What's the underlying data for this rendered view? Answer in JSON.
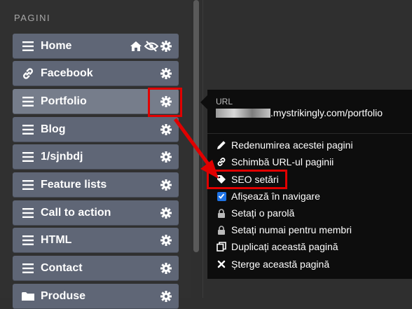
{
  "sidebar": {
    "title": "PAGINI",
    "items": [
      {
        "label": "Home",
        "icon": "hamburger-icon",
        "extra_icons": [
          "home-icon",
          "eye-slash-icon"
        ]
      },
      {
        "label": "Facebook",
        "icon": "link-icon"
      },
      {
        "label": "Portfolio",
        "icon": "hamburger-icon",
        "active": true
      },
      {
        "label": "Blog",
        "icon": "hamburger-icon"
      },
      {
        "label": "1/sjnbdj",
        "icon": "hamburger-icon"
      },
      {
        "label": "Feature lists",
        "icon": "hamburger-icon"
      },
      {
        "label": "Call to action",
        "icon": "hamburger-icon"
      },
      {
        "label": "HTML",
        "icon": "hamburger-icon"
      },
      {
        "label": "Contact",
        "icon": "hamburger-icon"
      },
      {
        "label": "Produse",
        "icon": "folder-icon"
      }
    ]
  },
  "popup": {
    "url_label": "URL",
    "url_value": ".mystrikingly.com/portfolio",
    "menu": {
      "rename": "Redenumirea acestei pagini",
      "change_url": "Schimbă URL-ul paginii",
      "seo": "SEO setări",
      "show_in_nav": "Afișează în navigare",
      "password": "Setați o parolă",
      "members_only": "Setați numai pentru membri",
      "duplicate": "Duplicați această pagină",
      "delete": "Șterge această pagină"
    }
  },
  "colors": {
    "highlight": "#e00000",
    "item_bg": "#5f6676",
    "item_active_bg": "#767d8b",
    "popup_bg": "#0d0d0d",
    "checkbox": "#1e73e6"
  }
}
